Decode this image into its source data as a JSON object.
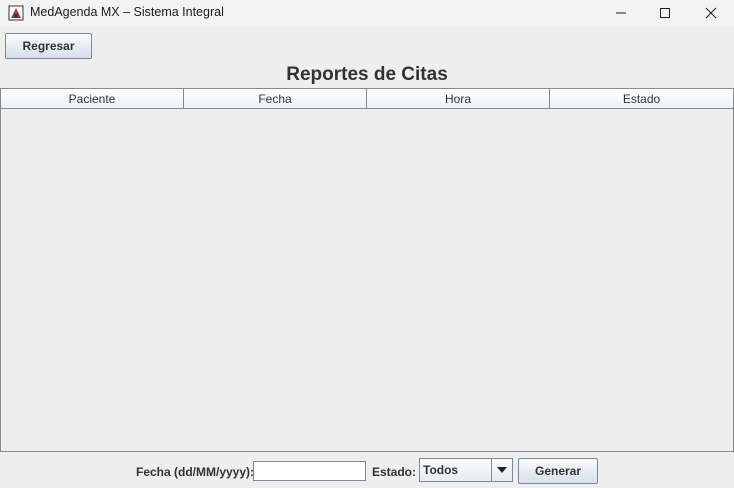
{
  "window": {
    "title": "MedAgenda MX – Sistema Integral",
    "minimize_glyph": "—",
    "maximize_glyph": "☐",
    "close_glyph": "✕"
  },
  "toolbar": {
    "back_label": "Regresar"
  },
  "page": {
    "title": "Reportes de Citas"
  },
  "table": {
    "columns": [
      "Paciente",
      "Fecha",
      "Hora",
      "Estado"
    ],
    "rows": []
  },
  "filters": {
    "date_label": "Fecha (dd/MM/yyyy):",
    "date_value": "",
    "status_label": "Estado:",
    "status_selected": "Todos",
    "generate_label": "Generar"
  },
  "icons": {
    "app": "app-logo-icon",
    "dropdown": "chevron-down-icon"
  }
}
